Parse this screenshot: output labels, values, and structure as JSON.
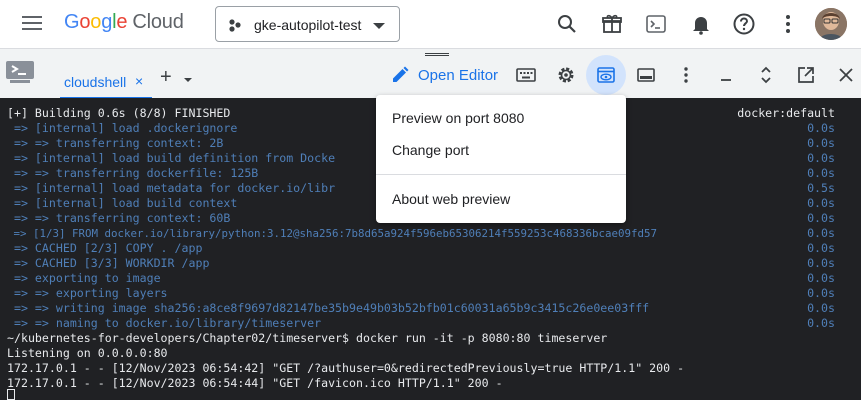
{
  "header": {
    "logo_google": [
      "G",
      "o",
      "o",
      "g",
      "l",
      "e"
    ],
    "logo_cloud": "Cloud",
    "project_name": "gke-autopilot-test"
  },
  "shell": {
    "tab_label": "cloudshell",
    "tab_close": "×",
    "new_tab": "+",
    "open_editor_label": "Open Editor"
  },
  "menu": {
    "items": [
      "Preview on port 8080",
      "Change port",
      "About web preview"
    ]
  },
  "terminal": {
    "lines": [
      {
        "text": "[+] Building 0.6s (8/8) FINISHED",
        "right": "docker:default",
        "color": "white"
      },
      {
        "text": " => [internal] load .dockerignore",
        "right": "0.0s",
        "color": "blue"
      },
      {
        "text": " => => transferring context: 2B",
        "right": "0.0s",
        "color": "blue"
      },
      {
        "text": " => [internal] load build definition from Docke",
        "right": "0.0s",
        "color": "blue"
      },
      {
        "text": " => => transferring dockerfile: 125B",
        "right": "0.0s",
        "color": "blue"
      },
      {
        "text": " => [internal] load metadata for docker.io/libr",
        "right": "0.5s",
        "color": "blue"
      },
      {
        "text": " => [internal] load build context",
        "right": "0.0s",
        "color": "blue"
      },
      {
        "text": " => => transferring context: 60B",
        "right": "0.0s",
        "color": "blue"
      },
      {
        "text": " => [1/3] FROM docker.io/library/python:3.12@sha256:7b8d65a924f596eb65306214f559253c468336bcae09fd57",
        "right": "0.0s",
        "color": "blue"
      },
      {
        "text": " => CACHED [2/3] COPY . /app",
        "right": "0.0s",
        "color": "blue"
      },
      {
        "text": " => CACHED [3/3] WORKDIR /app",
        "right": "0.0s",
        "color": "blue"
      },
      {
        "text": " => exporting to image",
        "right": "0.0s",
        "color": "blue"
      },
      {
        "text": " => => exporting layers",
        "right": "0.0s",
        "color": "blue"
      },
      {
        "text": " => => writing image sha256:a8ce8f9697d82147be35b9e49b03b52bfb01c60031a65b9c3415c26e0ee03fff",
        "right": "0.0s",
        "color": "blue"
      },
      {
        "text": " => => naming to docker.io/library/timeserver",
        "right": "0.0s",
        "color": "blue"
      },
      {
        "text": "~/kubernetes-for-developers/Chapter02/timeserver$ docker run -it -p 8080:80 timeserver",
        "right": "",
        "color": "white"
      },
      {
        "text": "Listening on 0.0.0.0:80",
        "right": "",
        "color": "white"
      },
      {
        "text": "172.17.0.1 - - [12/Nov/2023 06:54:42] \"GET /?authuser=0&redirectedPreviously=true HTTP/1.1\" 200 -",
        "right": "",
        "color": "white"
      },
      {
        "text": "172.17.0.1 - - [12/Nov/2023 06:54:44] \"GET /favicon.ico HTTP/1.1\" 200 -",
        "right": "",
        "color": "white"
      }
    ]
  },
  "icons": {
    "header": [
      "menu-icon",
      "project-icon",
      "search-icon",
      "gift-icon",
      "terminal-icon",
      "notifications-icon",
      "help-icon",
      "more-vert-icon"
    ],
    "shellbar": [
      "cloudshell-icon",
      "pencil-icon",
      "keyboard-icon",
      "settings-icon",
      "web-preview-icon",
      "split-icon",
      "more-vert-icon",
      "minimize-icon",
      "expand-icon",
      "open-new-window-icon",
      "close-icon"
    ]
  },
  "colors": {
    "accent": "#1a73e8",
    "terminal_bg": "#202124",
    "terminal_text": "#e8eaed",
    "terminal_dim": "#4f7fb8",
    "preview_active": "#d2e3fc"
  }
}
